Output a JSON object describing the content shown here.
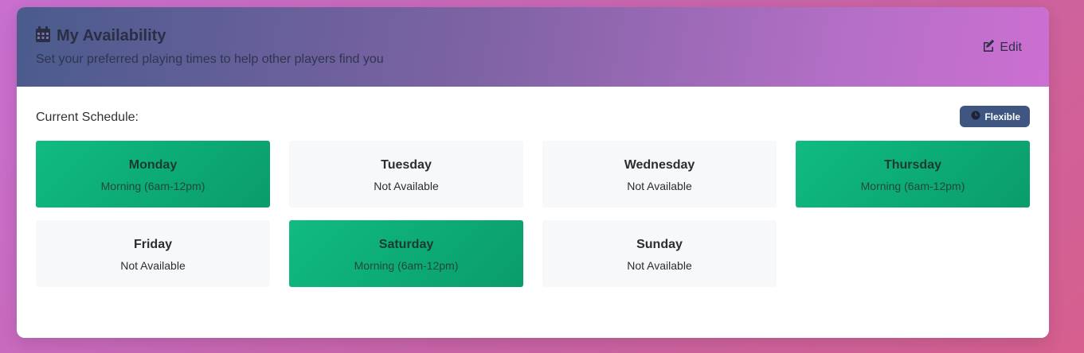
{
  "header": {
    "title": "My Availability",
    "subtitle": "Set your preferred playing times to help other players find you",
    "edit_label": "Edit",
    "title_icon": "calendar-icon",
    "edit_icon": "edit-icon"
  },
  "body": {
    "schedule_label": "Current Schedule:",
    "badge_label": "Flexible",
    "badge_icon": "clock-icon",
    "badge_color": "#3f5680",
    "available_color": "#10b981"
  },
  "days": [
    {
      "name": "Monday",
      "status": "Morning (6am-12pm)",
      "available": true
    },
    {
      "name": "Tuesday",
      "status": "Not Available",
      "available": false
    },
    {
      "name": "Wednesday",
      "status": "Not Available",
      "available": false
    },
    {
      "name": "Thursday",
      "status": "Morning (6am-12pm)",
      "available": true
    },
    {
      "name": "Friday",
      "status": "Not Available",
      "available": false
    },
    {
      "name": "Saturday",
      "status": "Morning (6am-12pm)",
      "available": true
    },
    {
      "name": "Sunday",
      "status": "Not Available",
      "available": false
    }
  ]
}
